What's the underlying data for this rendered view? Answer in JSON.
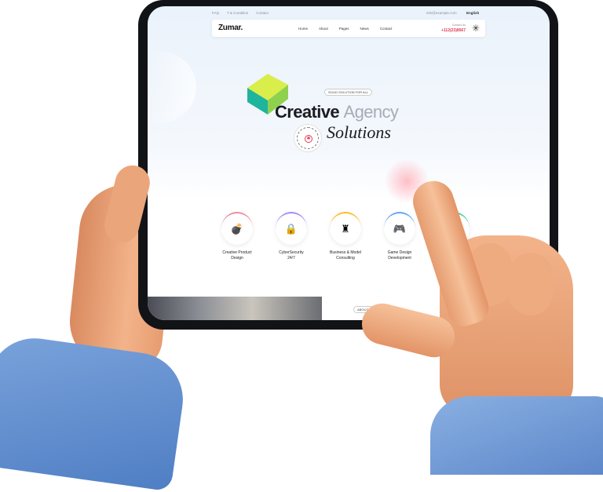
{
  "topbar": {
    "links": [
      "FAQ",
      "T & Condition",
      "Contact"
    ],
    "email": "info@example.com",
    "language": "English"
  },
  "navbar": {
    "logo": "Zumar.",
    "links": [
      "Home",
      "About",
      "Pages",
      "News",
      "Contact"
    ],
    "contact_label": "Contact Us",
    "contact_phone": "+112(23)8567"
  },
  "hero": {
    "tagline": "SOLID SOLUTION FOR ALL",
    "title_bold": "Creative",
    "title_light": "Agency",
    "subtitle": "Solutions",
    "badge_text": "DEAL FOR BRAND GROWING"
  },
  "services": [
    {
      "line1": "Creative Product",
      "line2": "Design",
      "icon": "bomb-icon"
    },
    {
      "line1": "CyberSecurity",
      "line2": "24/7",
      "icon": "lock-icon"
    },
    {
      "line1": "Business & Model",
      "line2": "Consulting",
      "icon": "chess-icon"
    },
    {
      "line1": "Game Design",
      "line2": "Development",
      "icon": "gamepad-icon"
    },
    {
      "line1": "",
      "line2": "",
      "icon": "gear-icon"
    }
  ],
  "about": {
    "tag": "ABOUT US"
  },
  "colors": {
    "accent": "#e23b55",
    "text_dark": "#1b1b22",
    "title_light": "#a4acb8",
    "sleeve": "#5b86c9",
    "skin": "#eba57b"
  }
}
